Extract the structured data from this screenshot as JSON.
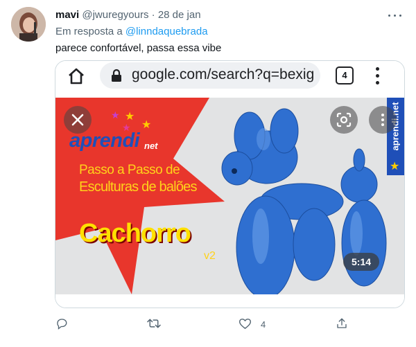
{
  "tweet": {
    "display_name": "mavi",
    "handle": "@jwuregyours",
    "separator": "·",
    "date": "28 de jan",
    "replying_prefix": "Em resposta a",
    "replying_to": "@linndaquebrada",
    "text": "parece confortável, passa essa vibe"
  },
  "browser": {
    "url": "google.com/search?q=bexig",
    "tab_count": "4"
  },
  "video": {
    "brand": "aprendi",
    "brand_suffix": "net",
    "line1": "Passo a Passo de",
    "line2": "Esculturas de balões",
    "title": "Cachorro",
    "version": "v2",
    "side_brand": "aprendi.net",
    "duration": "5:14"
  },
  "actions": {
    "reply_count": "",
    "retweet_count": "",
    "like_count": "4"
  },
  "colors": {
    "accent": "#1d9bf0",
    "muted": "#536471",
    "video_red": "#e8362c",
    "balloon_blue": "#2f6fd0"
  },
  "icons": [
    "home-icon",
    "lock-icon",
    "close-icon",
    "lens-icon",
    "more-vertical-icon",
    "reply-icon",
    "retweet-icon",
    "heart-icon",
    "share-icon"
  ]
}
